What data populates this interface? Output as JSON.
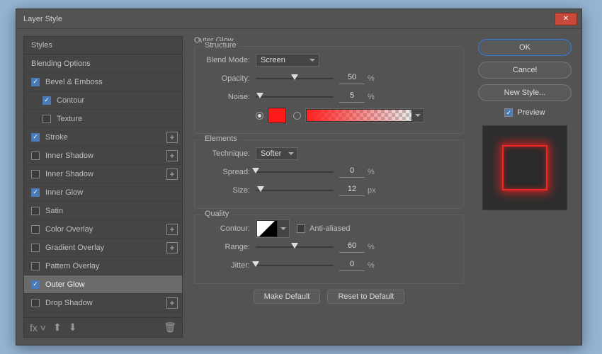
{
  "title": "Layer Style",
  "styles_header": "Styles",
  "styles": [
    {
      "label": "Blending Options",
      "cb": null,
      "plus": false,
      "indent": false
    },
    {
      "label": "Bevel & Emboss",
      "cb": true,
      "plus": false,
      "indent": false
    },
    {
      "label": "Contour",
      "cb": true,
      "plus": false,
      "indent": true
    },
    {
      "label": "Texture",
      "cb": false,
      "plus": false,
      "indent": true
    },
    {
      "label": "Stroke",
      "cb": true,
      "plus": true,
      "indent": false
    },
    {
      "label": "Inner Shadow",
      "cb": false,
      "plus": true,
      "indent": false
    },
    {
      "label": "Inner Shadow",
      "cb": false,
      "plus": true,
      "indent": false
    },
    {
      "label": "Inner Glow",
      "cb": true,
      "plus": false,
      "indent": false
    },
    {
      "label": "Satin",
      "cb": false,
      "plus": false,
      "indent": false
    },
    {
      "label": "Color Overlay",
      "cb": false,
      "plus": true,
      "indent": false
    },
    {
      "label": "Gradient Overlay",
      "cb": false,
      "plus": true,
      "indent": false
    },
    {
      "label": "Pattern Overlay",
      "cb": false,
      "plus": false,
      "indent": false
    },
    {
      "label": "Outer Glow",
      "cb": true,
      "plus": false,
      "indent": false,
      "selected": true
    },
    {
      "label": "Drop Shadow",
      "cb": false,
      "plus": true,
      "indent": false
    }
  ],
  "panel_title": "Outer Glow",
  "structure": {
    "legend": "Structure",
    "blend_mode_label": "Blend Mode:",
    "blend_mode": "Screen",
    "opacity_label": "Opacity:",
    "opacity": 50,
    "opacity_unit": "%",
    "noise_label": "Noise:",
    "noise": 5,
    "noise_unit": "%",
    "color": "#ff1a1a"
  },
  "elements": {
    "legend": "Elements",
    "technique_label": "Technique:",
    "technique": "Softer",
    "spread_label": "Spread:",
    "spread": 0,
    "spread_unit": "%",
    "size_label": "Size:",
    "size": 12,
    "size_unit": "px"
  },
  "quality": {
    "legend": "Quality",
    "contour_label": "Contour:",
    "antialiased_label": "Anti-aliased",
    "range_label": "Range:",
    "range": 60,
    "range_unit": "%",
    "jitter_label": "Jitter:",
    "jitter": 0,
    "jitter_unit": "%"
  },
  "buttons": {
    "make_default": "Make Default",
    "reset_default": "Reset to Default",
    "ok": "OK",
    "cancel": "Cancel",
    "new_style": "New Style...",
    "preview": "Preview"
  }
}
